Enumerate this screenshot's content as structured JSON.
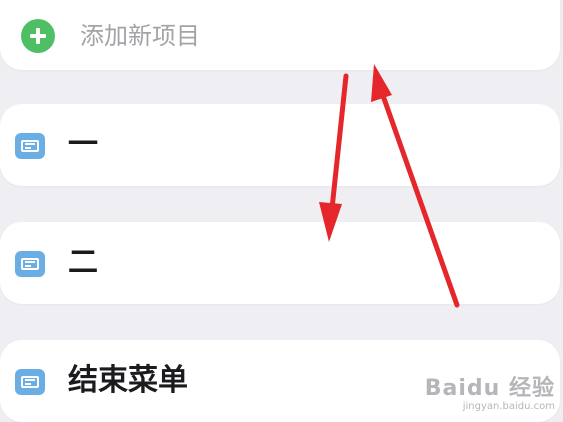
{
  "add_item": {
    "placeholder": "添加新项目",
    "icon": "plus-icon",
    "accent_color": "#4fbf66"
  },
  "items": [
    {
      "label": "一",
      "icon": "list-card-icon"
    },
    {
      "label": "二",
      "icon": "list-card-icon"
    },
    {
      "label": "结束菜单",
      "icon": "list-card-icon"
    }
  ],
  "item_icon_color": "#6aaee3",
  "annotation_color": "#e5262b",
  "watermark": {
    "brand": "Baidu 经验",
    "url": "jingyan.baidu.com"
  }
}
